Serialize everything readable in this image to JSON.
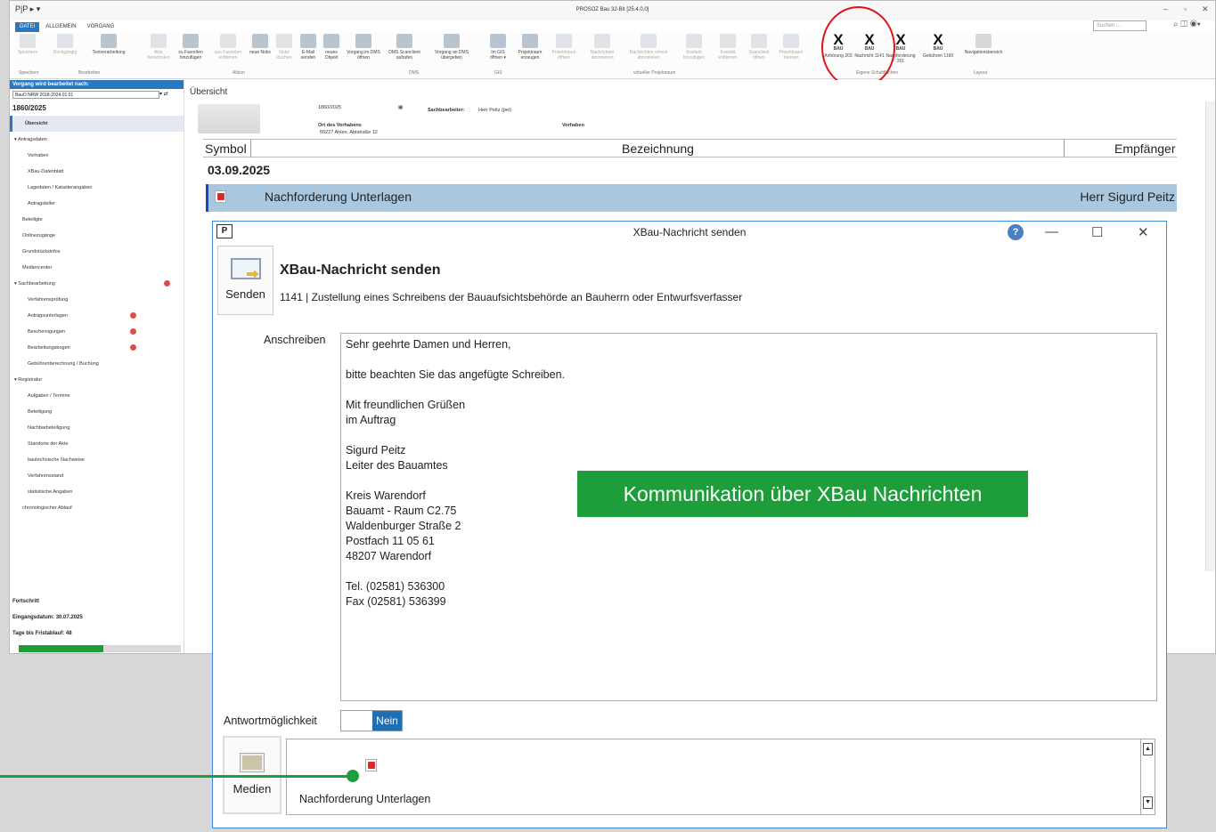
{
  "app": {
    "title": "PROSOZ Bau 32-Bit [25.4.0.0]",
    "tabs": [
      "DATEI",
      "ALLGEMEIN",
      "VORGANG"
    ],
    "search_placeholder": "Suchen ...",
    "quick_access": "P|P ▸ ▾"
  },
  "ribbon": {
    "buttons": [
      {
        "label": "Speichern",
        "dim": true
      },
      {
        "label": "Rückgängig",
        "dim": true
      },
      {
        "label": "Textverarbeitung",
        "dim": false
      },
      {
        "label": "Akte heranholen",
        "dim": true
      },
      {
        "label": "zu Favoriten hinzufügen",
        "dim": false
      },
      {
        "label": "aus Favoriten entfernen",
        "dim": true
      },
      {
        "label": "neue Notiz",
        "dim": false
      },
      {
        "label": "Notiz löschen",
        "dim": true
      },
      {
        "label": "E-Mail senden",
        "dim": false
      },
      {
        "label": "neues Objekt",
        "dim": false
      },
      {
        "label": "Vorgang im DMS öffnen",
        "dim": false
      },
      {
        "label": "DMS Scanclient aufrufen",
        "dim": false
      },
      {
        "label": "Vorgang an DMS übergeben",
        "dim": false
      },
      {
        "label": "Im GIS öffnen ▾",
        "dim": false
      },
      {
        "label": "Projektraum erzeugen",
        "dim": false
      },
      {
        "label": "Projektraum öffnen",
        "dim": true
      },
      {
        "label": "Nachrichten abonnieren",
        "dim": true
      },
      {
        "label": "Nachrichten erneut abonnieren",
        "dim": true
      },
      {
        "label": "Kontakt hinzufügen",
        "dim": true
      },
      {
        "label": "Kontakt entfernen",
        "dim": true
      },
      {
        "label": "Scanclient öffnen",
        "dim": true
      },
      {
        "label": "Projektraum trennen",
        "dim": true
      }
    ],
    "xbau": [
      {
        "label": "Anhörung 203",
        "code": "BAU"
      },
      {
        "label": "Nachricht 1141",
        "code": "BAU"
      },
      {
        "label": "Nachforderung 201",
        "code": "BAU"
      },
      {
        "label": "Gebühren 1160",
        "code": "BAU"
      }
    ],
    "navigation": "Navigationsbereich",
    "groups": [
      "Speichern",
      "Bearbeiten",
      "Aktion",
      "DMS",
      "GIS",
      "virtueller Projektraum",
      "Eigene Schaltflächen",
      "Layout"
    ]
  },
  "sidebar": {
    "header": "Vorgang wird bearbeitet nach:",
    "select_value": "BauO NRW 2018-2024.01.01",
    "case_number": "1860/2025",
    "items": [
      {
        "label": "Übersicht",
        "level": 1,
        "active": true,
        "badge": false
      },
      {
        "label": "▾ Antragsdaten",
        "level": 0,
        "active": false,
        "badge": false
      },
      {
        "label": "Vorhaben",
        "level": 2,
        "active": false,
        "badge": false
      },
      {
        "label": "XBau-Datenblatt",
        "level": 2,
        "active": false,
        "badge": false
      },
      {
        "label": "Lagedaten / Katasterangaben",
        "level": 2,
        "active": false,
        "badge": false
      },
      {
        "label": "Antragsteller",
        "level": 2,
        "active": false,
        "badge": false
      },
      {
        "label": "Beteiligte",
        "level": 1,
        "active": false,
        "badge": false
      },
      {
        "label": "Onlinezugänge",
        "level": 1,
        "active": false,
        "badge": false
      },
      {
        "label": "Grundstücksinfos",
        "level": 1,
        "active": false,
        "badge": false
      },
      {
        "label": "Mediencenter",
        "level": 1,
        "active": false,
        "badge": false
      },
      {
        "label": "▾ Sachbearbeitung",
        "level": 0,
        "active": false,
        "badge": true
      },
      {
        "label": "Verfahrensprüfung",
        "level": 2,
        "active": false,
        "badge": false
      },
      {
        "label": "Antragsunterlagen",
        "level": 2,
        "active": false,
        "badge": true
      },
      {
        "label": "Bescheinigungen",
        "level": 2,
        "active": false,
        "badge": true
      },
      {
        "label": "Bearbeitungsbogen",
        "level": 2,
        "active": false,
        "badge": true
      },
      {
        "label": "Gebührenberechnung / Buchung",
        "level": 2,
        "active": false,
        "badge": false
      },
      {
        "label": "▾ Registratur",
        "level": 0,
        "active": false,
        "badge": false
      },
      {
        "label": "Aufgaben / Termine",
        "level": 2,
        "active": false,
        "badge": false
      },
      {
        "label": "Beteiligung",
        "level": 2,
        "active": false,
        "badge": false
      },
      {
        "label": "Nachbarbeteiligung",
        "level": 2,
        "active": false,
        "badge": false
      },
      {
        "label": "Standorte der Akte",
        "level": 2,
        "active": false,
        "badge": false
      },
      {
        "label": "bautechnische Nachweise",
        "level": 2,
        "active": false,
        "badge": false
      },
      {
        "label": "Verfahrensstand",
        "level": 2,
        "active": false,
        "badge": false
      },
      {
        "label": "statistische Angaben",
        "level": 2,
        "active": false,
        "badge": false
      },
      {
        "label": "chronologischer Ablauf",
        "level": 1,
        "active": false,
        "badge": false
      }
    ],
    "progress_title": "Fortschritt",
    "eingang_label": "Eingangsdatum:",
    "eingang_value": "30.07.2025",
    "frist_label": "Tage bis Fristablauf:",
    "frist_value": "48",
    "progress_fraction": 0.52
  },
  "overview": {
    "label": "Übersicht",
    "case": "1860/2025",
    "sachbearbeiter_label": "Sachbearbeiter:",
    "sachbearbeiter_value": "Herr Peitz (pei)",
    "ort_label": "Ort des Vorhabens",
    "ort_value": "59227 Ahlen, Abtstraße 12",
    "vorhaben_label": "Vorhaben"
  },
  "grid": {
    "columns": [
      "Symbol",
      "Bezeichnung",
      "Empfänger"
    ],
    "date": "03.09.2025",
    "row": {
      "title": "Nachforderung Unterlagen",
      "recipient": "Herr Sigurd Peitz"
    }
  },
  "dialog": {
    "title": "XBau-Nachricht senden",
    "logo": "P",
    "heading": "XBau-Nachricht senden",
    "subtitle": "1141 | Zustellung eines Schreibens der Bauaufsichtsbehörde an Bauherrn oder Entwurfsverfasser",
    "send_label": "Senden",
    "anschreiben_label": "Anschreiben",
    "letter_lines": [
      "Sehr geehrte Damen und Herren,",
      "",
      "bitte beachten Sie das angefügte Schreiben.",
      "",
      "Mit freundlichen Grüßen",
      "im Auftrag",
      "",
      "Sigurd Peitz",
      "Leiter des Bauamtes",
      "",
      "Kreis Warendorf",
      "Bauamt - Raum C2.75",
      "Waldenburger Straße 2",
      "Postfach 11 05 61",
      "48207 Warendorf",
      "",
      "Tel. (02581) 536300",
      "Fax (02581) 536399"
    ],
    "antwort_label": "Antwortmöglichkeit",
    "antwort_value": "Nein",
    "media_label": "Medien",
    "attachment_name": "Nachforderung Unterlagen"
  },
  "callout": "Kommunikation über XBau Nachrichten",
  "colors": {
    "accent": "#2b78c2",
    "callout": "#1e9e3a",
    "highlight_circle": "#e0131b",
    "selected_row": "#a9c7de"
  }
}
